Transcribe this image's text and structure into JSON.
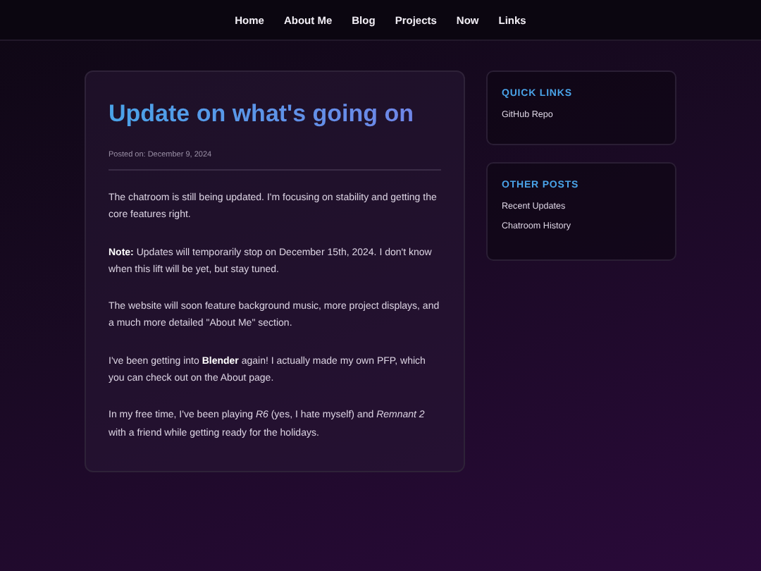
{
  "nav": {
    "items": [
      "Home",
      "About Me",
      "Blog",
      "Projects",
      "Now",
      "Links"
    ]
  },
  "post": {
    "title": "Update on what's going on",
    "meta": "Posted on: December 9, 2024",
    "paragraphs": [
      "The chatroom is still being updated. I'm focusing on stability and getting the core features right.",
      "**Note:** Updates will temporarily stop on December 15th, 2024. I don't know when this lift will be yet, but stay tuned.",
      "The website will soon feature background music, more project displays, and a much more detailed \"About Me\" section.",
      "I've been getting into **Blender** again! I actually made my own PFP, which you can check out on the About page.",
      "In my free time, I've been playing *R6* (yes, I hate myself) and *Remnant 2* with a friend while getting ready for the holidays."
    ]
  },
  "sidebar": [
    {
      "heading": "QUICK LINKS",
      "links": [
        "GitHub Repo"
      ]
    },
    {
      "heading": "OTHER POSTS",
      "links": [
        "Recent Updates",
        "Chatroom History"
      ]
    }
  ]
}
